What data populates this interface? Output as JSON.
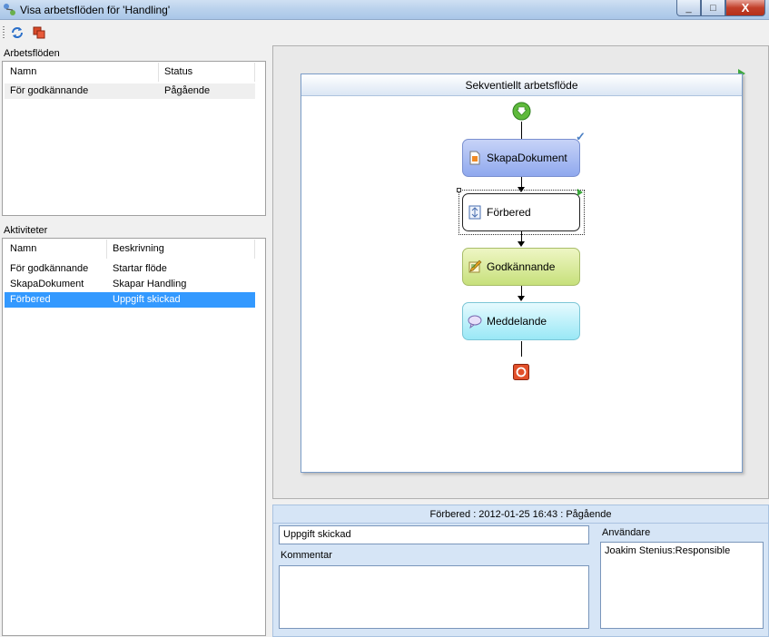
{
  "window": {
    "title": "Visa arbetsflöden för 'Handling'",
    "min_label": "_",
    "max_label": "□",
    "close_label": "X"
  },
  "toolbar": {
    "refresh_icon": "refresh-icon",
    "stop_icon": "stop-icon"
  },
  "workflows": {
    "label": "Arbetsflöden",
    "columns": [
      "Namn",
      "Status"
    ],
    "rows": [
      {
        "name": "För godkännande",
        "status": "Pågående"
      }
    ]
  },
  "activities": {
    "label": "Aktiviteter",
    "columns": [
      "Namn",
      "Beskrivning"
    ],
    "rows": [
      {
        "name": "För godkännande",
        "description": "Startar flöde"
      },
      {
        "name": "SkapaDokument",
        "description": "Skapar Handling"
      },
      {
        "name": "Förbered",
        "description": "Uppgift skickad"
      }
    ],
    "selected_index": 2
  },
  "designer": {
    "sequence_title": "Sekventiellt arbetsflöde",
    "steps": [
      {
        "label": "SkapaDokument",
        "icon": "document-icon",
        "status": "completed"
      },
      {
        "label": "Förbered",
        "icon": "task-icon",
        "status": "active"
      },
      {
        "label": "Godkännande",
        "icon": "approval-icon",
        "status": "pending"
      },
      {
        "label": "Meddelande",
        "icon": "message-icon",
        "status": "pending"
      }
    ],
    "completed_mark": "✓"
  },
  "detail": {
    "header": "Förbered : 2012-01-25 16:43 : Pågående",
    "task_value": "Uppgift skickad",
    "comment_label": "Kommentar",
    "comment_value": "",
    "users_label": "Användare",
    "users_value": "Joakim Stenius:Responsible"
  },
  "colors": {
    "selection": "#3399ff",
    "detail_bg": "#d6e5f6"
  }
}
